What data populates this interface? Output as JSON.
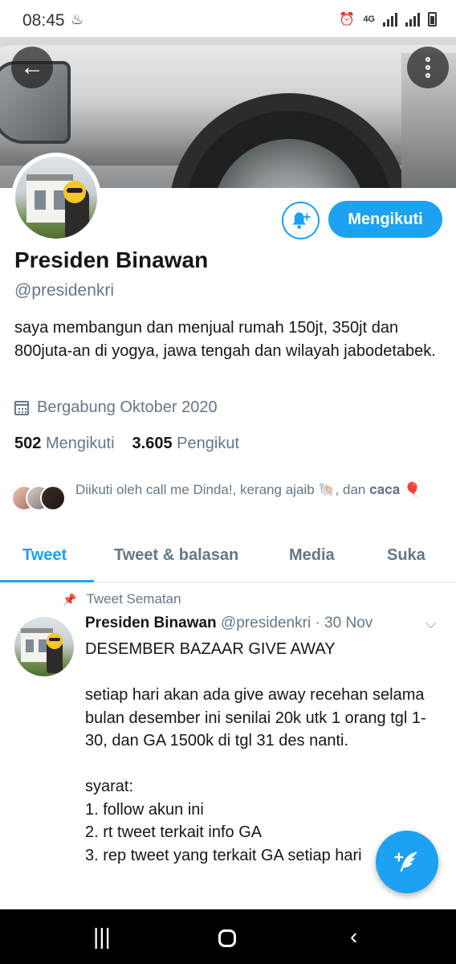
{
  "status_bar": {
    "time": "08:45",
    "network": "4G"
  },
  "profile": {
    "name": "Presiden Binawan",
    "handle": "@presidenkri",
    "bio": "saya membangun dan menjual rumah 150jt, 350jt dan 800juta-an di yogya, jawa tengah dan wilayah jabodetabek.",
    "joined": "Bergabung Oktober 2020",
    "following_count": "502",
    "following_label": "Mengikuti",
    "followers_count": "3.605",
    "followers_label": "Pengikut",
    "follow_button": "Mengikuti",
    "followed_by": "Diikuti oleh call me Dinda!, kerang ajaib 🐚, dan 𝐜𝐚𝐜𝐚 🎈"
  },
  "tabs": [
    {
      "label": "Tweet",
      "active": true
    },
    {
      "label": "Tweet & balasan",
      "active": false
    },
    {
      "label": "Media",
      "active": false
    },
    {
      "label": "Suka",
      "active": false
    }
  ],
  "pinned_tweet": {
    "pinned_label": "Tweet Sematan",
    "author": "Presiden Binawan",
    "handle": "@presidenkri",
    "date": "· 30 Nov",
    "text": "DESEMBER BAZAAR GIVE AWAY\n\nsetiap hari akan ada give away recehan selama bulan desember ini senilai 20k utk 1 orang tgl 1-30, dan GA 1500k di tgl 31 des nanti.\n\nsyarat:\n1. follow akun ini\n2. rt tweet terkait info GA\n3. rep tweet yang terkait GA setiap hari"
  },
  "colors": {
    "accent": "#1da1f2",
    "secondary_text": "#657786"
  },
  "icons": {
    "back": "back-arrow-icon",
    "more": "more-vertical-icon",
    "bell": "bell-plus-icon",
    "calendar": "calendar-icon",
    "pin": "pin-icon",
    "compose": "compose-tweet-icon"
  }
}
